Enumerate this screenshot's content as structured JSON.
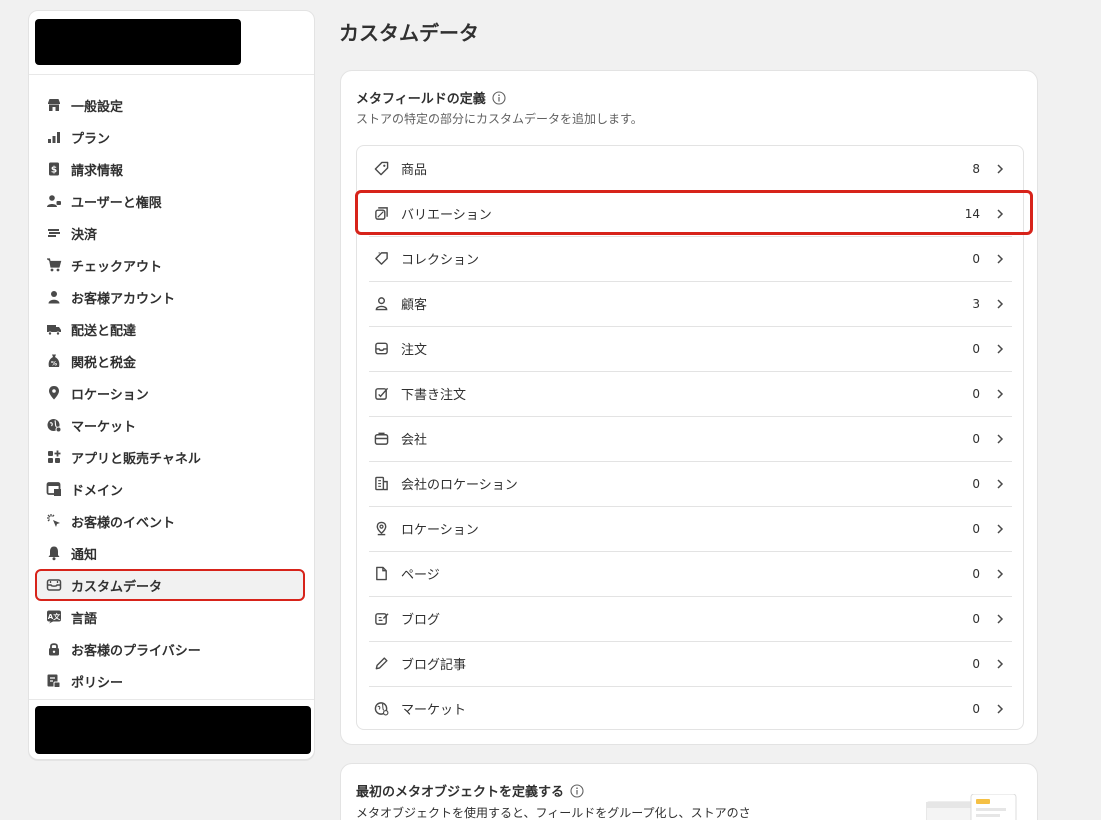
{
  "sidebar": {
    "items": [
      {
        "label": "一般設定",
        "icon": "store-icon"
      },
      {
        "label": "プラン",
        "icon": "plan-icon"
      },
      {
        "label": "請求情報",
        "icon": "billing-icon"
      },
      {
        "label": "ユーザーと権限",
        "icon": "users-icon"
      },
      {
        "label": "決済",
        "icon": "payments-icon"
      },
      {
        "label": "チェックアウト",
        "icon": "cart-icon"
      },
      {
        "label": "お客様アカウント",
        "icon": "person-icon"
      },
      {
        "label": "配送と配達",
        "icon": "truck-icon"
      },
      {
        "label": "関税と税金",
        "icon": "tax-icon"
      },
      {
        "label": "ロケーション",
        "icon": "location-icon"
      },
      {
        "label": "マーケット",
        "icon": "globe-icon"
      },
      {
        "label": "アプリと販売チャネル",
        "icon": "apps-icon"
      },
      {
        "label": "ドメイン",
        "icon": "domain-icon"
      },
      {
        "label": "お客様のイベント",
        "icon": "cursor-icon"
      },
      {
        "label": "通知",
        "icon": "bell-icon"
      },
      {
        "label": "カスタムデータ",
        "icon": "custom-data-icon",
        "active": true
      },
      {
        "label": "言語",
        "icon": "language-icon"
      },
      {
        "label": "お客様のプライバシー",
        "icon": "lock-icon"
      },
      {
        "label": "ポリシー",
        "icon": "policy-icon"
      }
    ]
  },
  "main": {
    "title": "カスタムデータ",
    "metafields": {
      "title": "メタフィールドの定義",
      "subtitle": "ストアの特定の部分にカスタムデータを追加します。",
      "rows": [
        {
          "label": "商品",
          "count": "8",
          "icon": "tag-icon"
        },
        {
          "label": "バリエーション",
          "count": "14",
          "icon": "variant-icon"
        },
        {
          "label": "コレクション",
          "count": "0",
          "icon": "collection-icon"
        },
        {
          "label": "顧客",
          "count": "3",
          "icon": "person-icon"
        },
        {
          "label": "注文",
          "count": "0",
          "icon": "inbox-icon"
        },
        {
          "label": "下書き注文",
          "count": "0",
          "icon": "draft-order-icon"
        },
        {
          "label": "会社",
          "count": "0",
          "icon": "briefcase-icon"
        },
        {
          "label": "会社のロケーション",
          "count": "0",
          "icon": "building-icon"
        },
        {
          "label": "ロケーション",
          "count": "0",
          "icon": "location-icon"
        },
        {
          "label": "ページ",
          "count": "0",
          "icon": "page-icon"
        },
        {
          "label": "ブログ",
          "count": "0",
          "icon": "blog-icon"
        },
        {
          "label": "ブログ記事",
          "count": "0",
          "icon": "pencil-icon"
        },
        {
          "label": "マーケット",
          "count": "0",
          "icon": "globe-icon"
        }
      ]
    },
    "metaobjects": {
      "title": "最初のメタオブジェクトを定義する",
      "description": "メタオブジェクトを使用すると、フィールドをグループ化し、ストアのさ"
    }
  },
  "colors": {
    "highlight": "#d7231a",
    "background": "#f1f1f1"
  }
}
